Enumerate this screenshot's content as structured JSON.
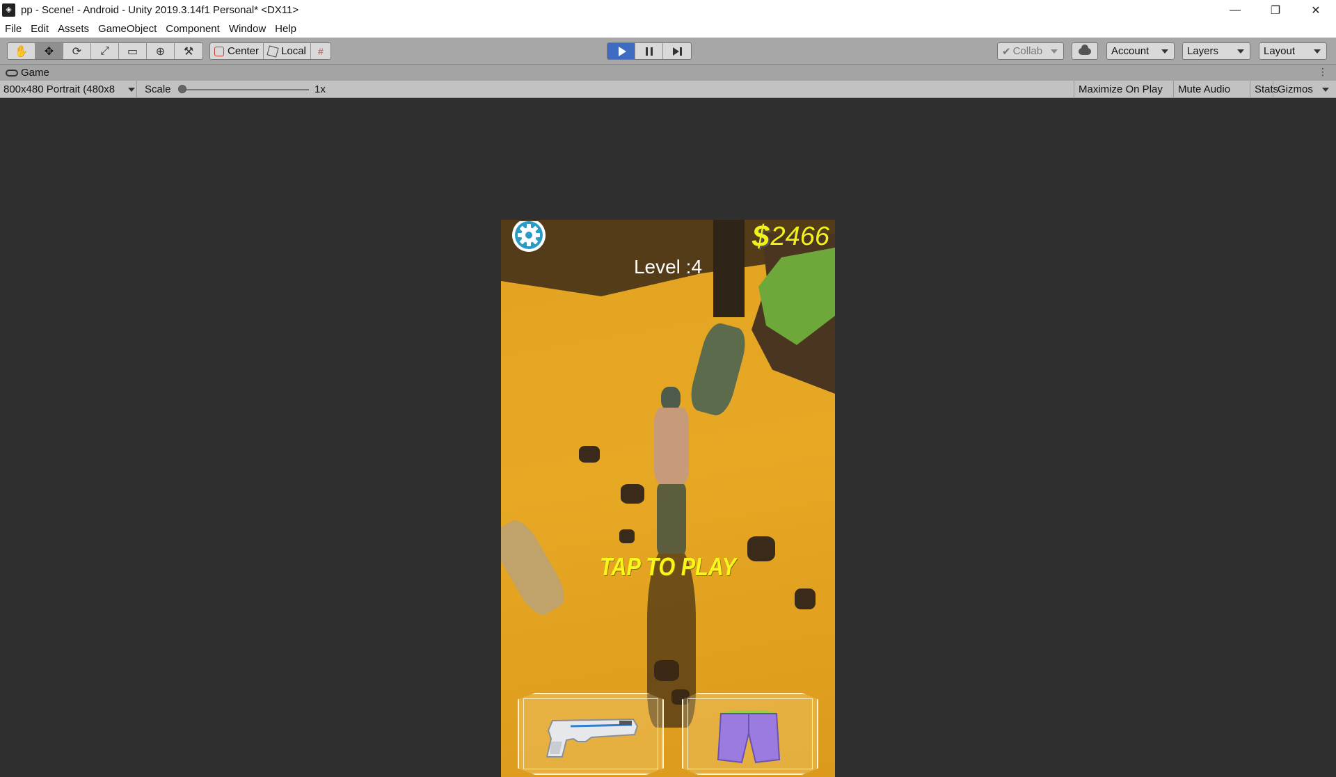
{
  "window": {
    "title": "pp - Scene! - Android - Unity 2019.3.14f1 Personal* <DX11>",
    "minimize": "—",
    "maximize": "❐",
    "close": "✕"
  },
  "menu": [
    "File",
    "Edit",
    "Assets",
    "GameObject",
    "Component",
    "Window",
    "Help"
  ],
  "toolbar": {
    "tools": [
      "hand-icon",
      "move-icon",
      "rotate-icon",
      "scale-icon",
      "rect-icon",
      "transform-icon",
      "custom-tool-icon"
    ],
    "pivot_center": "Center",
    "pivot_local": "Local",
    "collab": "Collab",
    "account": "Account",
    "layers": "Layers",
    "layout": "Layout"
  },
  "tab": {
    "label": "Game"
  },
  "game_bar": {
    "resolution": "800x480 Portrait (480x8",
    "scale_label": "Scale",
    "scale_value": "1x",
    "maximize_on_play": "Maximize On Play",
    "mute_audio": "Mute Audio",
    "stats": "Stats",
    "gizmos": "Gizmos"
  },
  "game": {
    "money_sign": "$",
    "money": "2466",
    "level": "Level :4",
    "tap_to_play": "TAP TO PLAY",
    "slots": [
      "gun-icon",
      "shorts-icon"
    ]
  },
  "colors": {
    "play_active": "#3d6cc2",
    "money": "#f2f21a",
    "ground": "#e2a322"
  }
}
